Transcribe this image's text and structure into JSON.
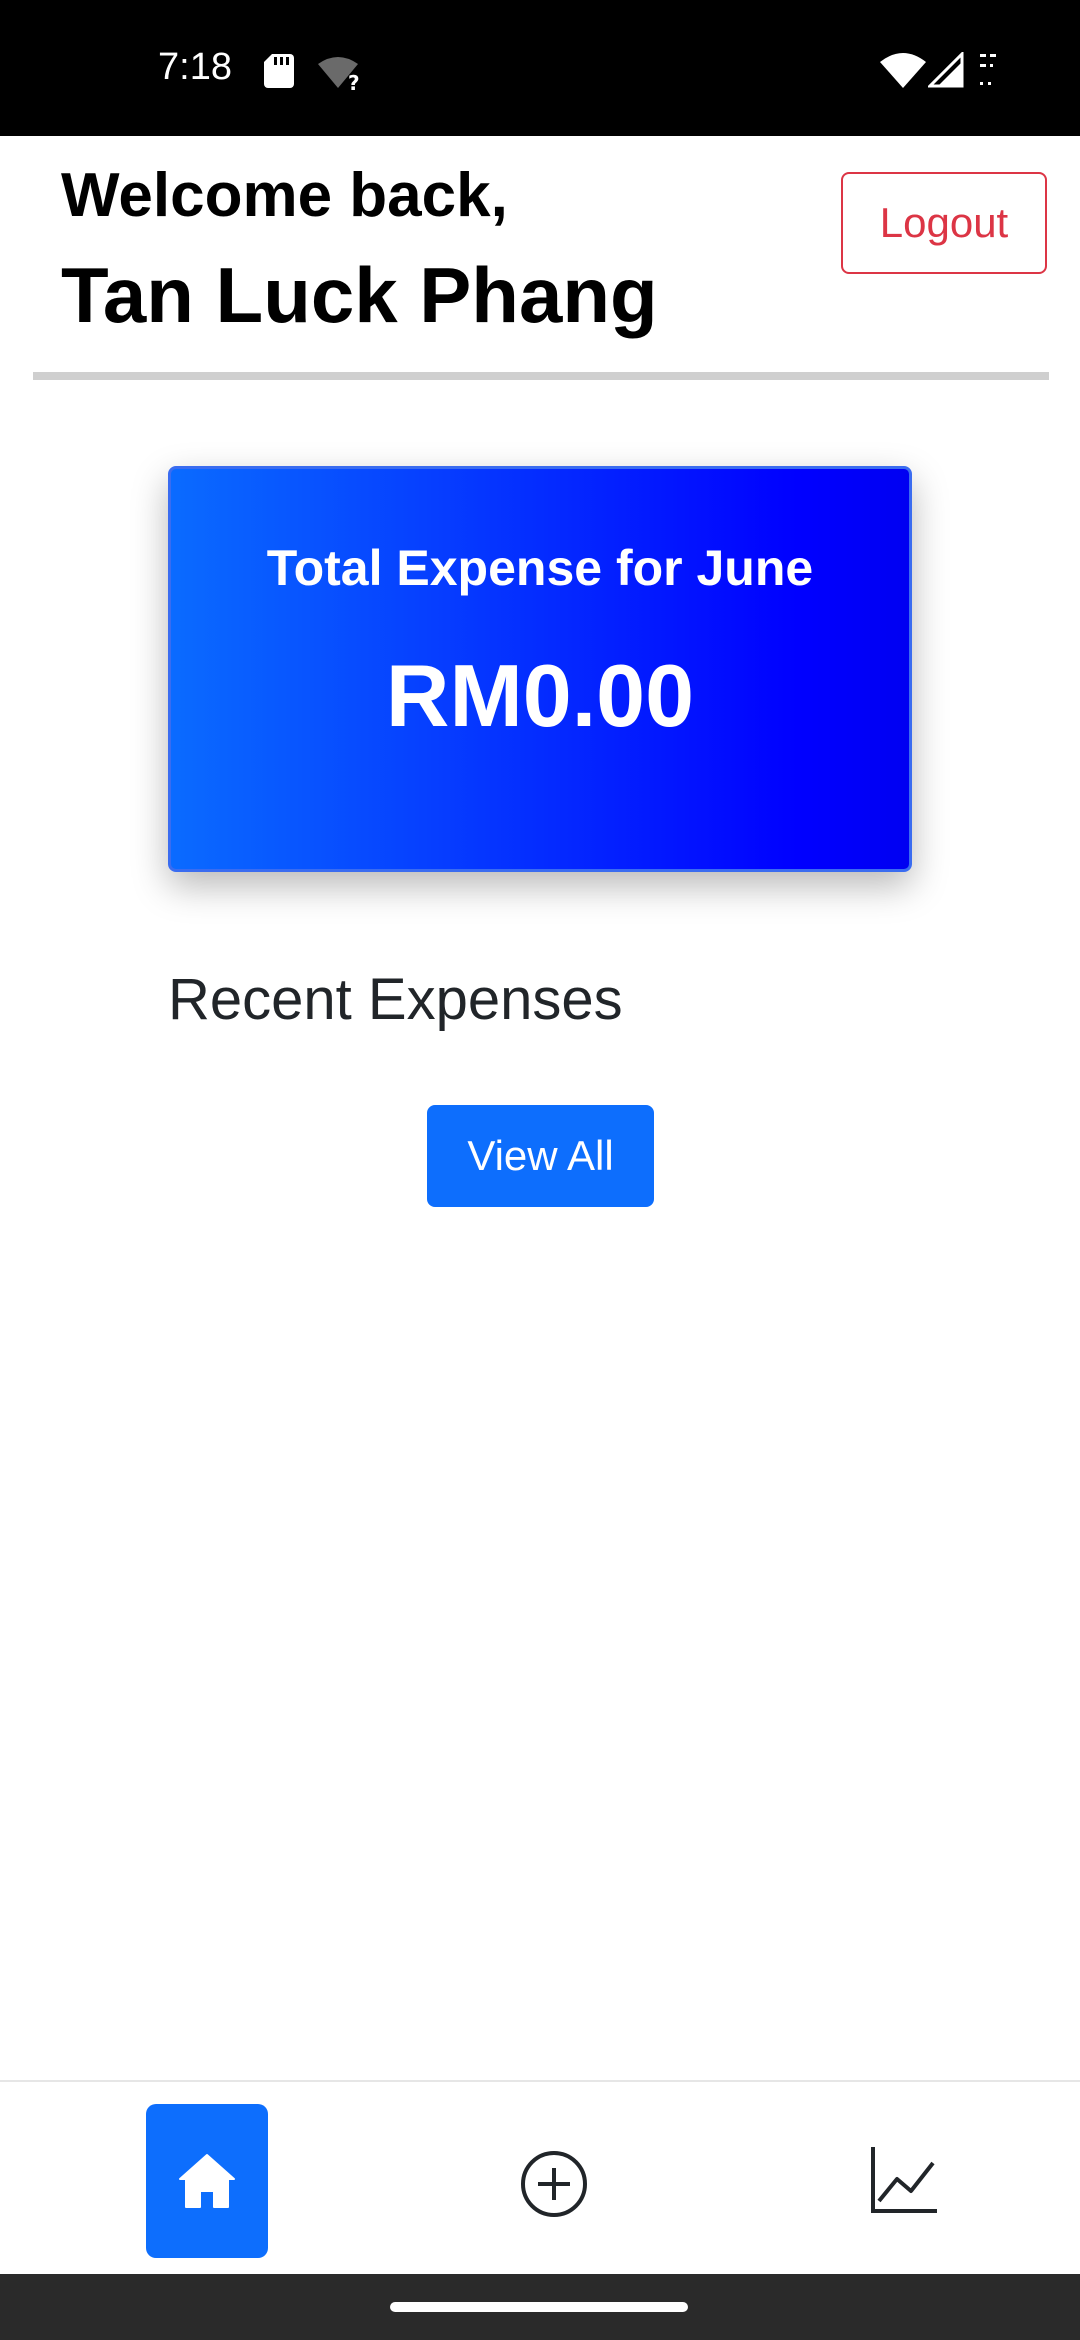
{
  "status_bar": {
    "time": "7:18",
    "icons": [
      "sd-card-icon",
      "wifi-question-icon",
      "wifi-icon",
      "signal-icon",
      "battery-icon"
    ]
  },
  "header": {
    "welcome": "Welcome back,",
    "user_name": "Tan Luck Phang",
    "logout_label": "Logout"
  },
  "expense_card": {
    "title": "Total Expense for June",
    "amount": "RM0.00"
  },
  "recent": {
    "heading": "Recent Expenses",
    "view_all_label": "View All"
  },
  "bottom_nav": {
    "items": [
      {
        "icon": "home-icon",
        "active": true
      },
      {
        "icon": "add-circle-icon",
        "active": false
      },
      {
        "icon": "chart-icon",
        "active": false
      }
    ]
  },
  "colors": {
    "accent": "#0d6efd",
    "danger": "#dc3545",
    "card_gradient_start": "#0a6bff",
    "card_gradient_end": "#0000ff"
  }
}
